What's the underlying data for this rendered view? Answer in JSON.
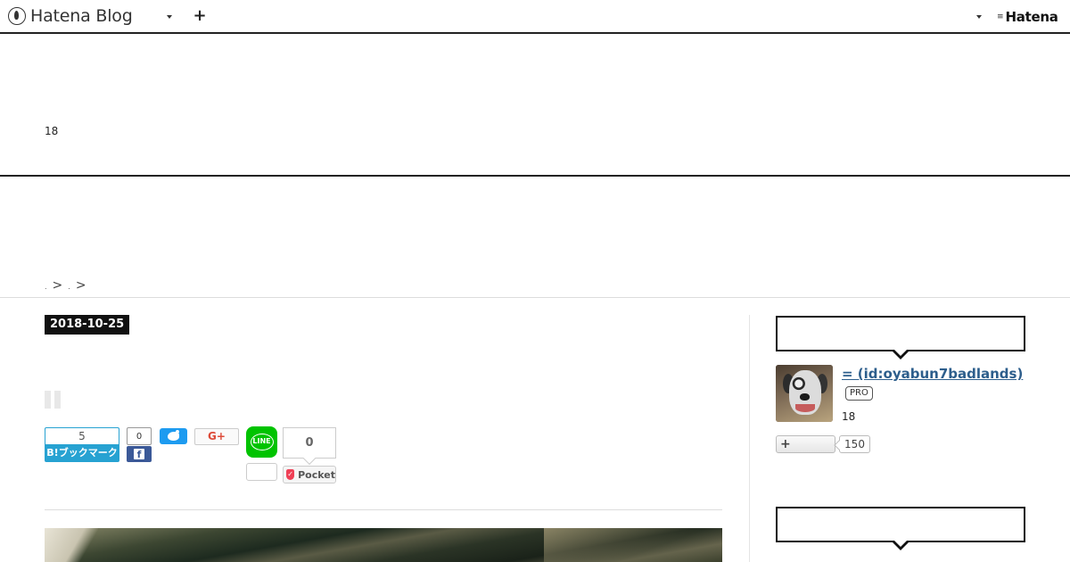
{
  "global_header": {
    "brand": "Hatena Blog",
    "plus_label": "+",
    "right_logo_text": "Hatena"
  },
  "blog_header": {
    "description": "18"
  },
  "breadcrumb": {
    "separators": [
      ">",
      ">"
    ]
  },
  "entry": {
    "date": "2018-10-25",
    "share": {
      "hatena_bookmark_count": "5",
      "hatena_bookmark_label": "B!ブックマーク",
      "facebook_count": "0",
      "facebook_icon": "f",
      "google_plus_label": "G+",
      "line_label": "LINE",
      "pocket_count": "0",
      "pocket_label": "Pocket"
    }
  },
  "sidebar": {
    "profile": {
      "name": "= (id:oyabun7badlands)",
      "badge": "PRO",
      "description": "18",
      "follow_label": "+",
      "follower_count": "150"
    }
  },
  "colors": {
    "hatena_bookmark": "#27a2d2",
    "facebook": "#3b5998",
    "twitter": "#1d9bf0",
    "line": "#00c300",
    "pocket": "#ef4056",
    "link": "#2d5e8c"
  }
}
